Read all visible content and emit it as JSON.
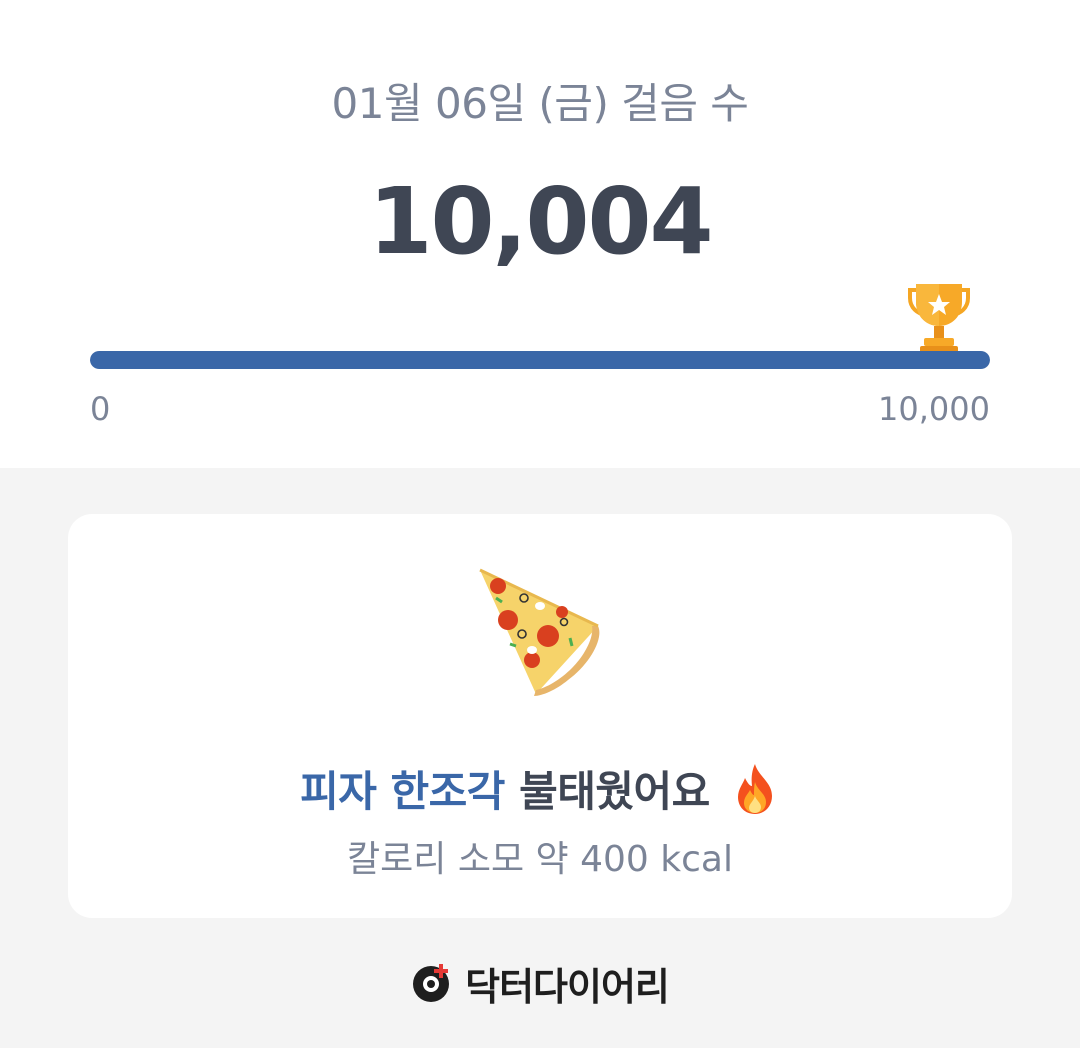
{
  "header": {
    "date_title": "01월 06일 (금) 걸음 수",
    "step_count": "10,004"
  },
  "progress": {
    "min_label": "0",
    "max_label": "10,000",
    "fraction": 1.0,
    "colors": {
      "fill": "#3a67a8",
      "track": "#e3e6ec"
    },
    "goal_icon": "trophy-icon"
  },
  "card": {
    "food_icon": "pizza-icon",
    "headline_accent": "피자 한조각",
    "headline_rest": "불태웠어요",
    "effect_icon": "fire-icon",
    "calorie_text": "칼로리 소모 약 400 kcal"
  },
  "brand": {
    "logo_icon": "doctor-diary-logo-icon",
    "name": "닥터다이어리"
  }
}
